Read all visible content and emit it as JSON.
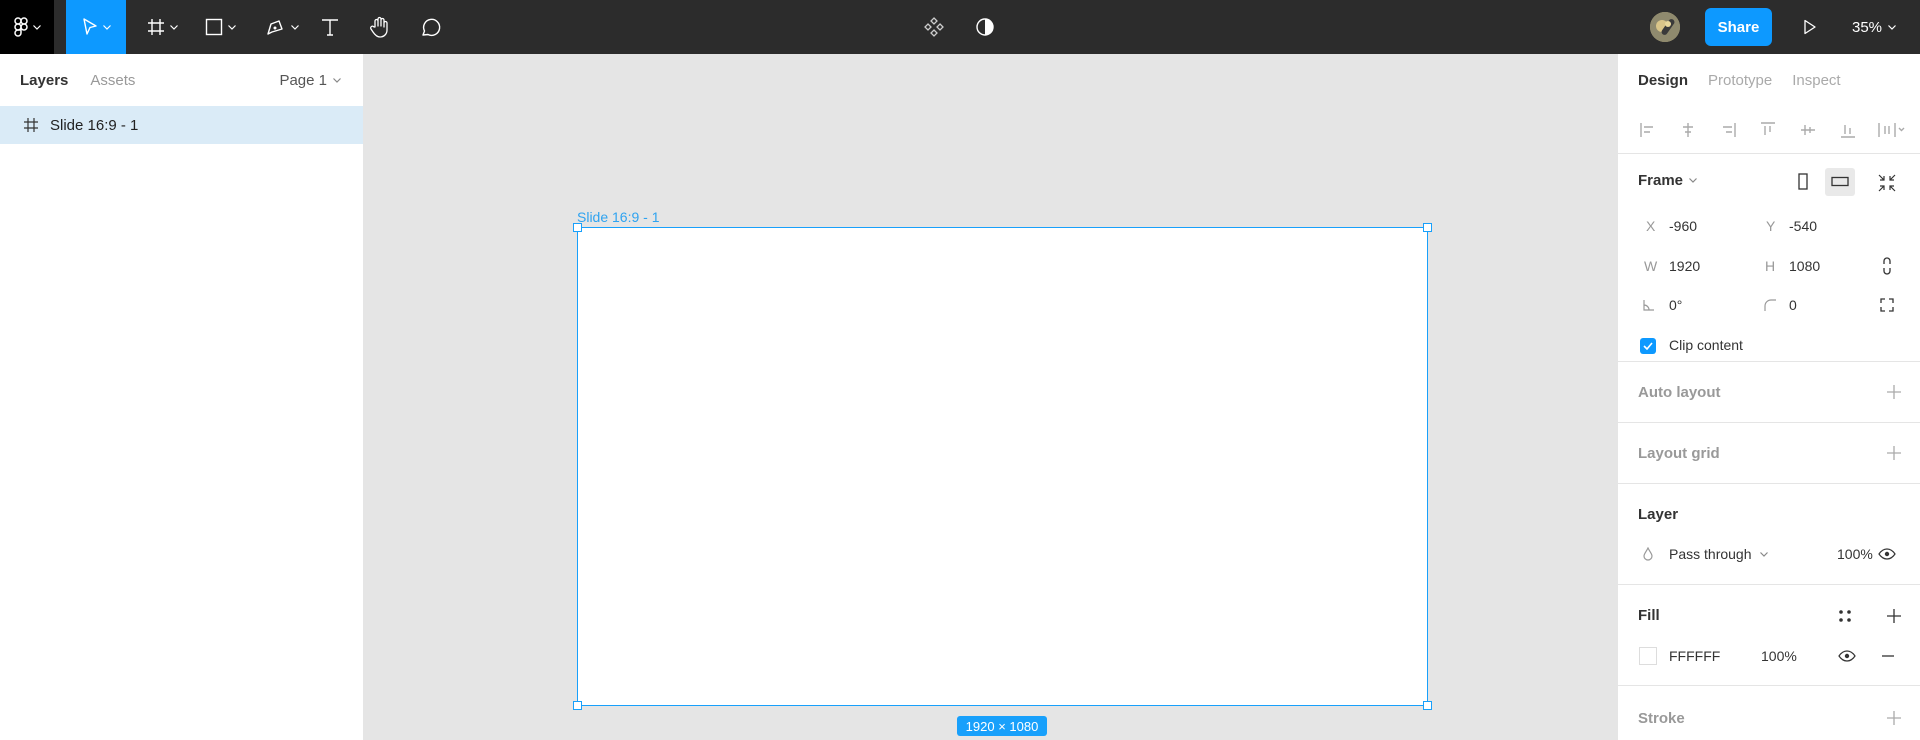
{
  "toolbar": {
    "share_label": "Share",
    "zoom_label": "35%"
  },
  "left_panel": {
    "tabs": [
      {
        "label": "Layers"
      },
      {
        "label": "Assets"
      }
    ],
    "page_label": "Page 1",
    "layers": [
      {
        "label": "Slide 16:9 - 1"
      }
    ]
  },
  "canvas": {
    "frame_label": "Slide 16:9 - 1",
    "size_badge": "1920 × 1080"
  },
  "right_panel": {
    "tabs": [
      {
        "label": "Design"
      },
      {
        "label": "Prototype"
      },
      {
        "label": "Inspect"
      }
    ],
    "frame": {
      "title": "Frame",
      "x_label": "X",
      "x_value": "-960",
      "y_label": "Y",
      "y_value": "-540",
      "w_label": "W",
      "w_value": "1920",
      "h_label": "H",
      "h_value": "1080",
      "rotation_value": "0°",
      "radius_value": "0",
      "clip_label": "Clip content"
    },
    "auto_layout_title": "Auto layout",
    "layout_grid_title": "Layout grid",
    "layer": {
      "title": "Layer",
      "blend_mode": "Pass through",
      "opacity": "100%"
    },
    "fill": {
      "title": "Fill",
      "hex": "FFFFFF",
      "opacity": "100%"
    },
    "stroke_title": "Stroke"
  },
  "colors": {
    "accent": "#0d99ff",
    "toolbar_bg": "#2c2c2c",
    "canvas_bg": "#e5e5e5",
    "selection": "#daebf7"
  }
}
